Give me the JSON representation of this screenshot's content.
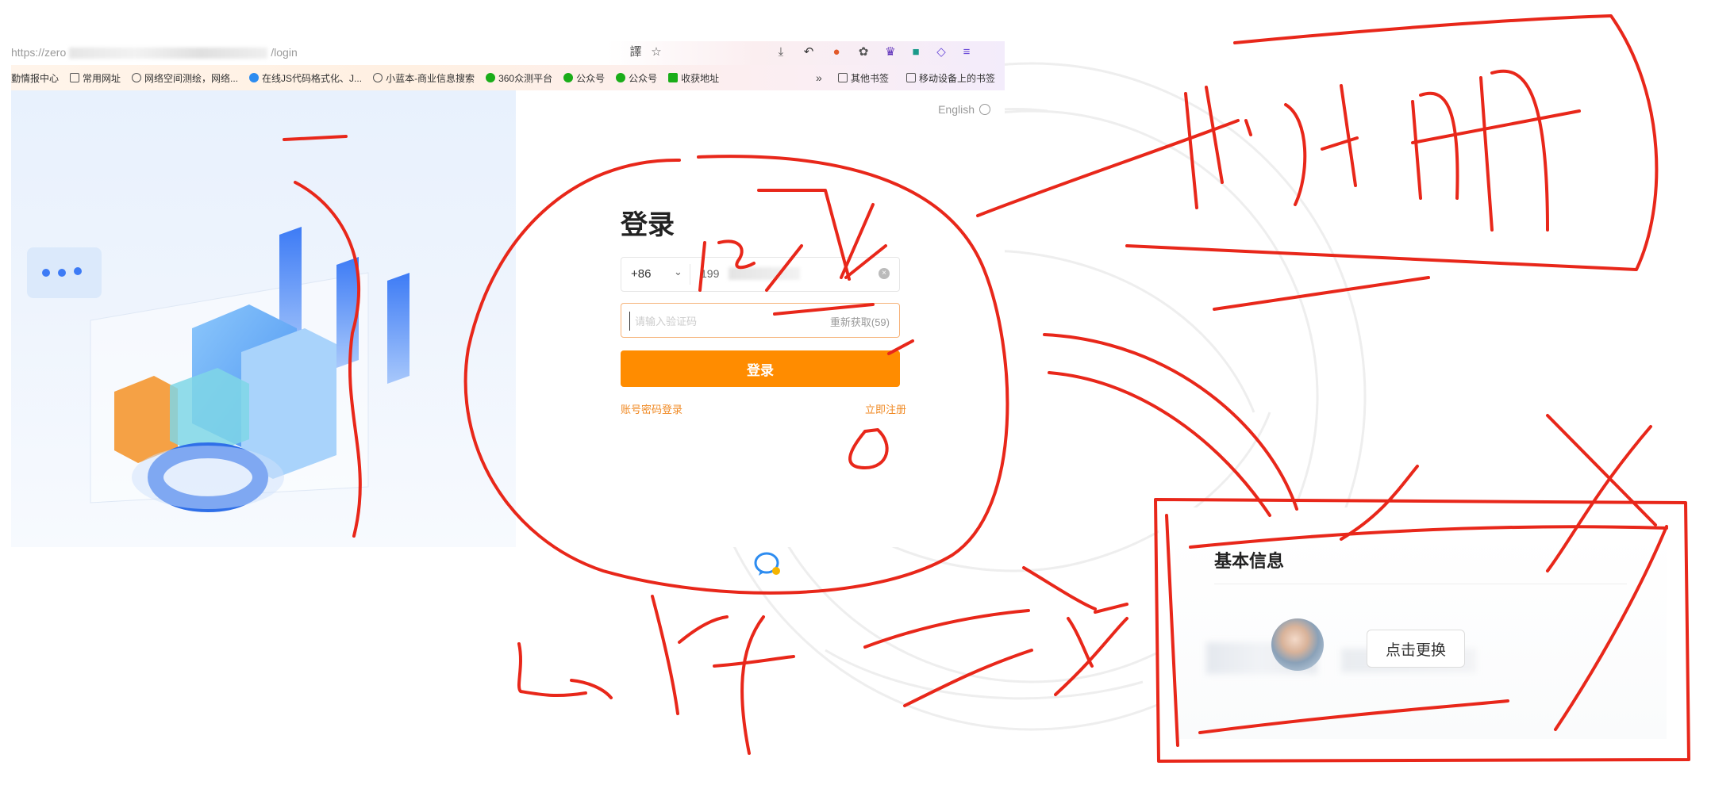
{
  "browser": {
    "url_prefix": "https://zero",
    "url_suffix": "/login",
    "addr_icons": [
      "translate-icon",
      "star-icon",
      "download-icon",
      "back-arrow-icon",
      "extension-icon",
      "puzzle-icon",
      "owl-icon",
      "reader-icon",
      "share-icon",
      "menu-icon"
    ],
    "bookmarks": [
      {
        "label": "勤情报中心",
        "icon": "none"
      },
      {
        "label": "常用网址",
        "icon": "folder"
      },
      {
        "label": "网络空间测绘，网络...",
        "icon": "round"
      },
      {
        "label": "在线JS代码格式化、J...",
        "icon": "blue"
      },
      {
        "label": "小蓝本-商业信息搜索",
        "icon": "round"
      },
      {
        "label": "360众测平台",
        "icon": "green"
      },
      {
        "label": "公众号",
        "icon": "green"
      },
      {
        "label": "公众号",
        "icon": "green"
      },
      {
        "label": "收获地址",
        "icon": "green"
      }
    ],
    "bookmarks_right": [
      {
        "label": "其他书签",
        "icon": "folder"
      },
      {
        "label": "移动设备上的书签",
        "icon": "folder"
      }
    ],
    "more_symbol": "»"
  },
  "login": {
    "language": "English",
    "title": "登录",
    "country_code": "+86",
    "phone_value": "199",
    "code_placeholder": "请输入验证码",
    "resend_label": "重新获取(59)",
    "login_button": "登录",
    "password_login_link": "账号密码登录",
    "register_link": "立即注册"
  },
  "profile": {
    "section_title": "基本信息",
    "change_avatar_button": "点击更换"
  },
  "annotation_color": "#e8271a"
}
